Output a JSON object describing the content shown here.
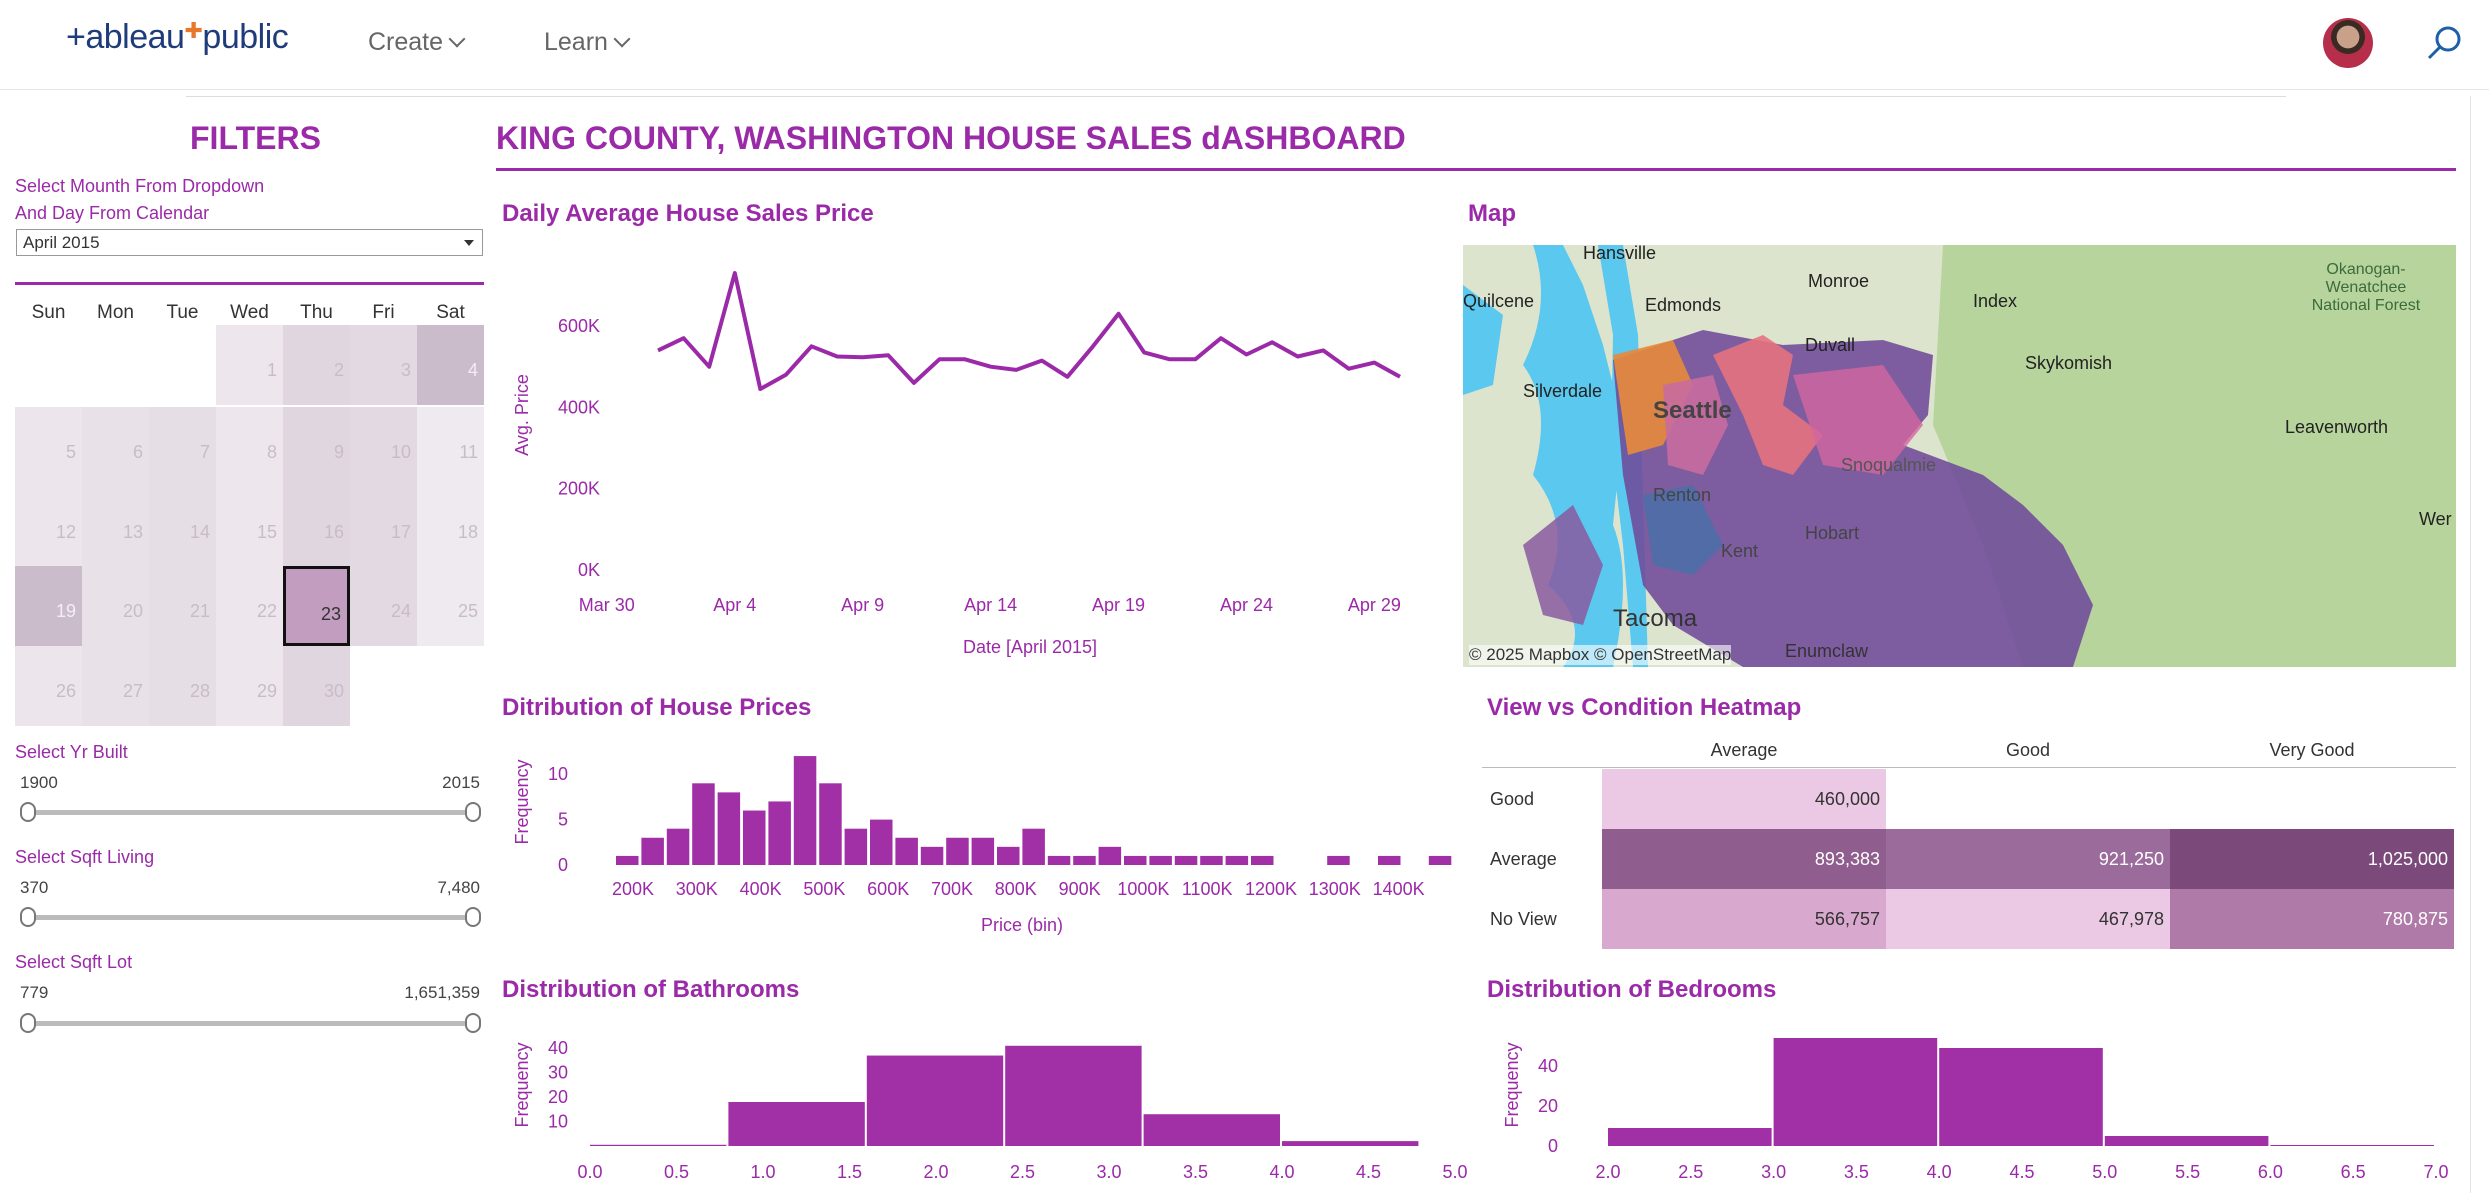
{
  "nav": {
    "logo_left": "+ableau",
    "logo_right": "public",
    "create": "Create",
    "learn": "Learn"
  },
  "filters": {
    "title": "FILTERS",
    "instr1": "Select Mounth From Dropdown",
    "instr2": "And Day From Calendar",
    "month_value": "April 2015",
    "weekdays": [
      "Sun",
      "Mon",
      "Tue",
      "Wed",
      "Thu",
      "Fri",
      "Sat"
    ],
    "selected_day": "23",
    "yr_built": {
      "label": "Select Yr Built",
      "min": "1900",
      "max": "2015"
    },
    "sqft_living": {
      "label": "Select Sqft Living",
      "min": "370",
      "max": "7,480"
    },
    "sqft_lot": {
      "label": "Select Sqft Lot",
      "min": "779",
      "max": "1,651,359"
    }
  },
  "dashboard_title": "KING COUNTY, WASHINGTON HOUSE SALES dASHBOARD",
  "sections": {
    "daily": "Daily Average House Sales Price",
    "map": "Map",
    "dist_prices": "Ditribution of House Prices",
    "heatmap": "View vs Condition Heatmap",
    "bathrooms": "Distribution of Bathrooms",
    "bedrooms": "Distribution of Bedrooms"
  },
  "map": {
    "labels": [
      "Hansville",
      "Quilcene",
      "Edmonds",
      "Monroe",
      "Index",
      "Okanogan-\nWenatchee\nNational Forest",
      "Duvall",
      "Skykomish",
      "Silverdale",
      "Seattle",
      "Leavenworth",
      "Snoqualmie",
      "Renton",
      "Hobart",
      "Kent",
      "Tacoma",
      "Enumclaw",
      "Wer"
    ],
    "attribution_mapbox": "© 2025 Mapbox",
    "attribution_osm": "© OpenStreetMap",
    "colors": {
      "water": "#5bc8f0",
      "land": "#dfe6cf",
      "forest": "#b9d6a0",
      "region_purple": "#6f4a9a"
    }
  },
  "chart_data": [
    {
      "type": "line",
      "title": "Daily Average House Sales Price",
      "xlabel": "Date [April 2015]",
      "ylabel": "Avg. Price",
      "x_ticks": [
        "Mar 30",
        "Apr 4",
        "Apr 9",
        "Apr 14",
        "Apr 19",
        "Apr 24",
        "Apr 29"
      ],
      "y_ticks": [
        "0K",
        "200K",
        "400K",
        "600K"
      ],
      "ylim": [
        0,
        750000
      ],
      "x": [
        "Apr 1",
        "Apr 2",
        "Apr 3",
        "Apr 4",
        "Apr 5",
        "Apr 6",
        "Apr 7",
        "Apr 8",
        "Apr 9",
        "Apr 10",
        "Apr 11",
        "Apr 12",
        "Apr 13",
        "Apr 14",
        "Apr 15",
        "Apr 16",
        "Apr 17",
        "Apr 18",
        "Apr 19",
        "Apr 20",
        "Apr 21",
        "Apr 22",
        "Apr 23",
        "Apr 24",
        "Apr 25",
        "Apr 26",
        "Apr 27",
        "Apr 28",
        "Apr 29",
        "Apr 30"
      ],
      "values": [
        540000,
        570000,
        500000,
        730000,
        445000,
        480000,
        550000,
        525000,
        523000,
        528000,
        460000,
        518000,
        518000,
        500000,
        492000,
        515000,
        475000,
        550000,
        630000,
        535000,
        518000,
        518000,
        570000,
        530000,
        560000,
        525000,
        540000,
        495000,
        510000,
        475000
      ],
      "color": "#9b2aa8"
    },
    {
      "type": "bar",
      "title": "Ditribution of House Prices",
      "xlabel": "Price (bin)",
      "ylabel": "Frequency",
      "x_ticks": [
        "200K",
        "300K",
        "400K",
        "500K",
        "600K",
        "700K",
        "800K",
        "900K",
        "1000K",
        "1100K",
        "1200K",
        "1300K",
        "1400K"
      ],
      "y_ticks": [
        "0",
        "5",
        "10"
      ],
      "ylim": [
        0,
        13
      ],
      "bin_start": 200000,
      "bin_width": 37500,
      "values": [
        1,
        3,
        4,
        9,
        8,
        6,
        7,
        12,
        9,
        4,
        5,
        3,
        2,
        3,
        3,
        2,
        4,
        1,
        1,
        2,
        1,
        1,
        1,
        1,
        1,
        1,
        0,
        0,
        1,
        0,
        1,
        0,
        1
      ],
      "color": "#a12fa6"
    },
    {
      "type": "heatmap",
      "title": "View vs Condition Heatmap",
      "columns": [
        "Average",
        "Good",
        "Very Good"
      ],
      "rows": [
        "Good",
        "Average",
        "No View"
      ],
      "values": [
        [
          "460,000",
          "",
          ""
        ],
        [
          "893,383",
          "921,250",
          "1,025,000"
        ],
        [
          "566,757",
          "467,978",
          "780,875"
        ]
      ],
      "cell_colors": [
        [
          "#ebc9e4",
          "",
          ""
        ],
        [
          "#8f5e8f",
          "#9b6b9b",
          "#7b4a7b"
        ],
        [
          "#d9a8cf",
          "#ebc9e4",
          "#b07aa8"
        ]
      ],
      "text_colors": [
        [
          "#333",
          "",
          ""
        ],
        [
          "#fff",
          "#fff",
          "#fff"
        ],
        [
          "#333",
          "#333",
          "#fff"
        ]
      ]
    },
    {
      "type": "bar",
      "title": "Distribution of Bathrooms",
      "ylabel": "Frequency",
      "x_ticks": [
        "0.0",
        "0.5",
        "1.0",
        "1.5",
        "2.0",
        "2.5",
        "3.0",
        "3.5",
        "4.0",
        "4.5",
        "5.0"
      ],
      "y_ticks": [
        "10",
        "20",
        "30",
        "40"
      ],
      "ylim": [
        0,
        45
      ],
      "bins": [
        [
          0,
          0.8,
          0.5
        ],
        [
          0.8,
          1.6,
          18
        ],
        [
          1.6,
          2.4,
          37
        ],
        [
          2.4,
          3.2,
          41
        ],
        [
          3.2,
          4.0,
          13
        ],
        [
          4.0,
          4.8,
          2
        ]
      ],
      "color": "#a12fa6"
    },
    {
      "type": "bar",
      "title": "Distribution of Bedrooms",
      "ylabel": "Frequency",
      "x_ticks": [
        "2.0",
        "2.5",
        "3.0",
        "3.5",
        "4.0",
        "4.5",
        "5.0",
        "5.5",
        "6.0",
        "6.5",
        "7.0"
      ],
      "y_ticks": [
        "0",
        "20",
        "40"
      ],
      "ylim": [
        0,
        55
      ],
      "bins": [
        [
          2.0,
          3.0,
          9
        ],
        [
          3.0,
          4.0,
          54
        ],
        [
          4.0,
          5.0,
          49
        ],
        [
          5.0,
          6.0,
          5
        ],
        [
          6.0,
          7.0,
          0.5
        ]
      ],
      "color": "#a12fa6"
    }
  ]
}
